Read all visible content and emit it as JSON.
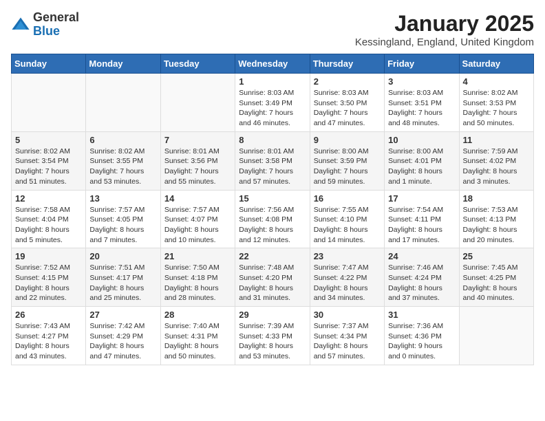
{
  "header": {
    "logo_general": "General",
    "logo_blue": "Blue",
    "month": "January 2025",
    "location": "Kessingland, England, United Kingdom"
  },
  "weekdays": [
    "Sunday",
    "Monday",
    "Tuesday",
    "Wednesday",
    "Thursday",
    "Friday",
    "Saturday"
  ],
  "weeks": [
    [
      {
        "day": "",
        "detail": ""
      },
      {
        "day": "",
        "detail": ""
      },
      {
        "day": "",
        "detail": ""
      },
      {
        "day": "1",
        "detail": "Sunrise: 8:03 AM\nSunset: 3:49 PM\nDaylight: 7 hours and 46 minutes."
      },
      {
        "day": "2",
        "detail": "Sunrise: 8:03 AM\nSunset: 3:50 PM\nDaylight: 7 hours and 47 minutes."
      },
      {
        "day": "3",
        "detail": "Sunrise: 8:03 AM\nSunset: 3:51 PM\nDaylight: 7 hours and 48 minutes."
      },
      {
        "day": "4",
        "detail": "Sunrise: 8:02 AM\nSunset: 3:53 PM\nDaylight: 7 hours and 50 minutes."
      }
    ],
    [
      {
        "day": "5",
        "detail": "Sunrise: 8:02 AM\nSunset: 3:54 PM\nDaylight: 7 hours and 51 minutes."
      },
      {
        "day": "6",
        "detail": "Sunrise: 8:02 AM\nSunset: 3:55 PM\nDaylight: 7 hours and 53 minutes."
      },
      {
        "day": "7",
        "detail": "Sunrise: 8:01 AM\nSunset: 3:56 PM\nDaylight: 7 hours and 55 minutes."
      },
      {
        "day": "8",
        "detail": "Sunrise: 8:01 AM\nSunset: 3:58 PM\nDaylight: 7 hours and 57 minutes."
      },
      {
        "day": "9",
        "detail": "Sunrise: 8:00 AM\nSunset: 3:59 PM\nDaylight: 7 hours and 59 minutes."
      },
      {
        "day": "10",
        "detail": "Sunrise: 8:00 AM\nSunset: 4:01 PM\nDaylight: 8 hours and 1 minute."
      },
      {
        "day": "11",
        "detail": "Sunrise: 7:59 AM\nSunset: 4:02 PM\nDaylight: 8 hours and 3 minutes."
      }
    ],
    [
      {
        "day": "12",
        "detail": "Sunrise: 7:58 AM\nSunset: 4:04 PM\nDaylight: 8 hours and 5 minutes."
      },
      {
        "day": "13",
        "detail": "Sunrise: 7:57 AM\nSunset: 4:05 PM\nDaylight: 8 hours and 7 minutes."
      },
      {
        "day": "14",
        "detail": "Sunrise: 7:57 AM\nSunset: 4:07 PM\nDaylight: 8 hours and 10 minutes."
      },
      {
        "day": "15",
        "detail": "Sunrise: 7:56 AM\nSunset: 4:08 PM\nDaylight: 8 hours and 12 minutes."
      },
      {
        "day": "16",
        "detail": "Sunrise: 7:55 AM\nSunset: 4:10 PM\nDaylight: 8 hours and 14 minutes."
      },
      {
        "day": "17",
        "detail": "Sunrise: 7:54 AM\nSunset: 4:11 PM\nDaylight: 8 hours and 17 minutes."
      },
      {
        "day": "18",
        "detail": "Sunrise: 7:53 AM\nSunset: 4:13 PM\nDaylight: 8 hours and 20 minutes."
      }
    ],
    [
      {
        "day": "19",
        "detail": "Sunrise: 7:52 AM\nSunset: 4:15 PM\nDaylight: 8 hours and 22 minutes."
      },
      {
        "day": "20",
        "detail": "Sunrise: 7:51 AM\nSunset: 4:17 PM\nDaylight: 8 hours and 25 minutes."
      },
      {
        "day": "21",
        "detail": "Sunrise: 7:50 AM\nSunset: 4:18 PM\nDaylight: 8 hours and 28 minutes."
      },
      {
        "day": "22",
        "detail": "Sunrise: 7:48 AM\nSunset: 4:20 PM\nDaylight: 8 hours and 31 minutes."
      },
      {
        "day": "23",
        "detail": "Sunrise: 7:47 AM\nSunset: 4:22 PM\nDaylight: 8 hours and 34 minutes."
      },
      {
        "day": "24",
        "detail": "Sunrise: 7:46 AM\nSunset: 4:24 PM\nDaylight: 8 hours and 37 minutes."
      },
      {
        "day": "25",
        "detail": "Sunrise: 7:45 AM\nSunset: 4:25 PM\nDaylight: 8 hours and 40 minutes."
      }
    ],
    [
      {
        "day": "26",
        "detail": "Sunrise: 7:43 AM\nSunset: 4:27 PM\nDaylight: 8 hours and 43 minutes."
      },
      {
        "day": "27",
        "detail": "Sunrise: 7:42 AM\nSunset: 4:29 PM\nDaylight: 8 hours and 47 minutes."
      },
      {
        "day": "28",
        "detail": "Sunrise: 7:40 AM\nSunset: 4:31 PM\nDaylight: 8 hours and 50 minutes."
      },
      {
        "day": "29",
        "detail": "Sunrise: 7:39 AM\nSunset: 4:33 PM\nDaylight: 8 hours and 53 minutes."
      },
      {
        "day": "30",
        "detail": "Sunrise: 7:37 AM\nSunset: 4:34 PM\nDaylight: 8 hours and 57 minutes."
      },
      {
        "day": "31",
        "detail": "Sunrise: 7:36 AM\nSunset: 4:36 PM\nDaylight: 9 hours and 0 minutes."
      },
      {
        "day": "",
        "detail": ""
      }
    ]
  ]
}
